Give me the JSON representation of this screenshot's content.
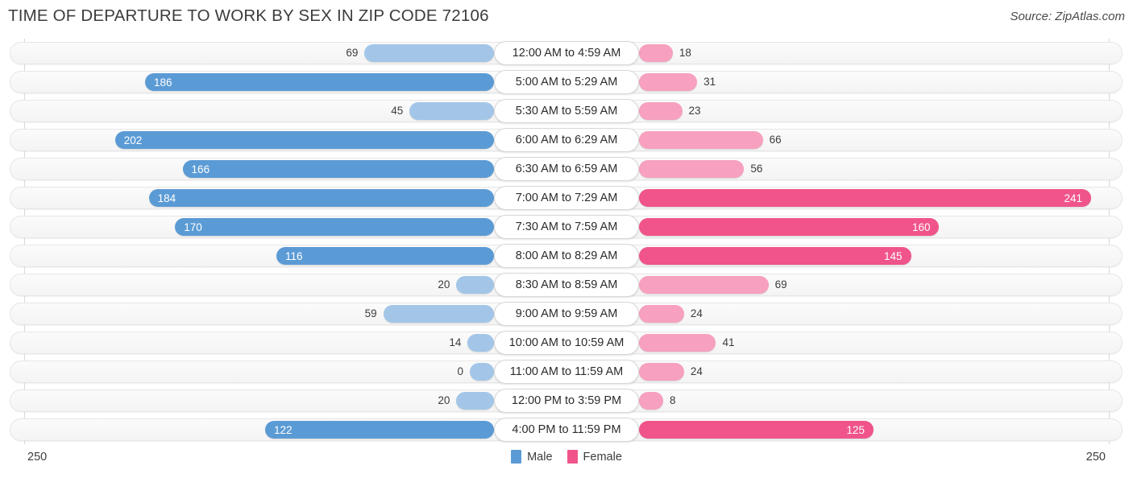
{
  "header": {
    "title": "TIME OF DEPARTURE TO WORK BY SEX IN ZIP CODE 72106",
    "source": "Source: ZipAtlas.com"
  },
  "axis": {
    "left_max_label": "250",
    "right_max_label": "250",
    "max": 250
  },
  "legend": {
    "items": [
      {
        "label": "Male",
        "color": "#5b9bd5"
      },
      {
        "label": "Female",
        "color": "#f0548a"
      }
    ]
  },
  "colors": {
    "male_strong": "#5b9bd5",
    "male_light": "#a3c6e8",
    "female_strong": "#f0548a",
    "female_light": "#f7a0bf",
    "track": "#f7f7f7",
    "axis_line": "#d9d9d9"
  },
  "chart_data": {
    "type": "bar",
    "title": "TIME OF DEPARTURE TO WORK BY SEX IN ZIP CODE 72106",
    "subtitle": "",
    "xlabel": "",
    "ylabel": "",
    "orientation": "horizontal-diverging",
    "xlim": [
      0,
      250
    ],
    "grid": false,
    "legend_position": "bottom-center",
    "categories": [
      "12:00 AM to 4:59 AM",
      "5:00 AM to 5:29 AM",
      "5:30 AM to 5:59 AM",
      "6:00 AM to 6:29 AM",
      "6:30 AM to 6:59 AM",
      "7:00 AM to 7:29 AM",
      "7:30 AM to 7:59 AM",
      "8:00 AM to 8:29 AM",
      "8:30 AM to 8:59 AM",
      "9:00 AM to 9:59 AM",
      "10:00 AM to 10:59 AM",
      "11:00 AM to 11:59 AM",
      "12:00 PM to 3:59 PM",
      "4:00 PM to 11:59 PM"
    ],
    "series": [
      {
        "name": "Male",
        "color": "#5b9bd5",
        "values": [
          69,
          186,
          45,
          202,
          166,
          184,
          170,
          116,
          20,
          59,
          14,
          0,
          20,
          122
        ]
      },
      {
        "name": "Female",
        "color": "#f0548a",
        "values": [
          18,
          31,
          23,
          66,
          56,
          241,
          160,
          145,
          69,
          24,
          41,
          24,
          8,
          125
        ]
      }
    ]
  },
  "rows": [
    {
      "category": "12:00 AM to 4:59 AM",
      "male": 69,
      "female": 18
    },
    {
      "category": "5:00 AM to 5:29 AM",
      "male": 186,
      "female": 31
    },
    {
      "category": "5:30 AM to 5:59 AM",
      "male": 45,
      "female": 23
    },
    {
      "category": "6:00 AM to 6:29 AM",
      "male": 202,
      "female": 66
    },
    {
      "category": "6:30 AM to 6:59 AM",
      "male": 166,
      "female": 56
    },
    {
      "category": "7:00 AM to 7:29 AM",
      "male": 184,
      "female": 241
    },
    {
      "category": "7:30 AM to 7:59 AM",
      "male": 170,
      "female": 160
    },
    {
      "category": "8:00 AM to 8:29 AM",
      "male": 116,
      "female": 145
    },
    {
      "category": "8:30 AM to 8:59 AM",
      "male": 20,
      "female": 69
    },
    {
      "category": "9:00 AM to 9:59 AM",
      "male": 59,
      "female": 24
    },
    {
      "category": "10:00 AM to 10:59 AM",
      "male": 14,
      "female": 41
    },
    {
      "category": "11:00 AM to 11:59 AM",
      "male": 0,
      "female": 24
    },
    {
      "category": "12:00 PM to 3:59 PM",
      "male": 20,
      "female": 8
    },
    {
      "category": "4:00 PM to 11:59 PM",
      "male": 122,
      "female": 125
    }
  ]
}
